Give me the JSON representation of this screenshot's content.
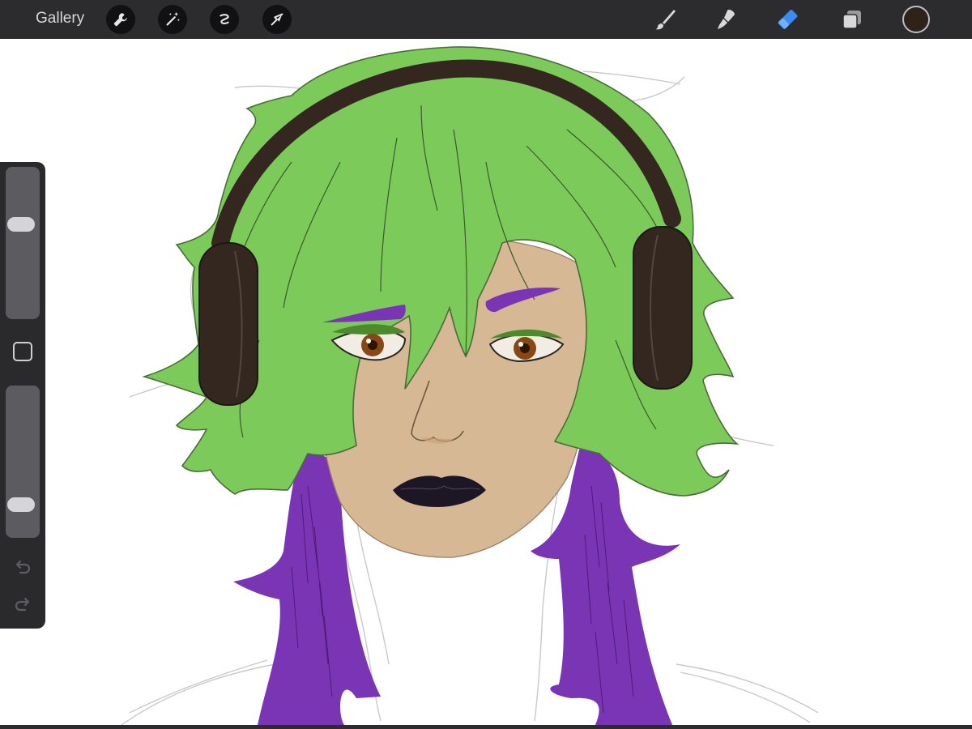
{
  "toolbar": {
    "gallery_label": "Gallery",
    "left_tools": [
      "wrench-icon",
      "magic-wand-icon",
      "selection-icon",
      "transform-icon"
    ],
    "right_tools": [
      "brush-icon",
      "smudge-icon",
      "eraser-icon",
      "layers-icon"
    ],
    "active_tool": "eraser-icon",
    "current_color": "#2e2219"
  },
  "sidebar": {
    "brush_size_level": 0.64,
    "opacity_level": 0.17,
    "undo_icon": "undo-icon",
    "redo_icon": "redo-icon"
  },
  "colors": {
    "hair_green": "#7ccb5a",
    "hair_purple": "#7a35b5",
    "skin": "#d6b895",
    "headphones": "#33271f",
    "lips": "#1d1624",
    "iris": "#8a4716",
    "accent_blue": "#3a8bf2"
  }
}
